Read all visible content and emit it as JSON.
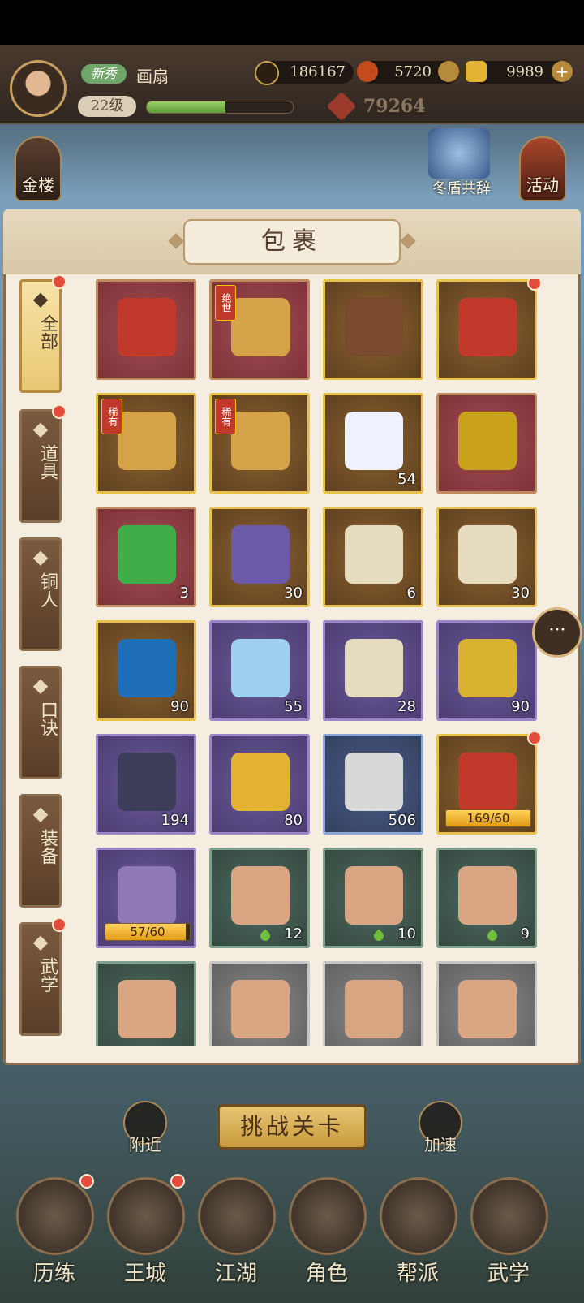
{
  "header": {
    "rank_badge": "新秀",
    "player_name": "画扇",
    "level": "22级",
    "exp_fraction": 0.54,
    "resources": [
      {
        "name": "coins",
        "icon": "coin-icon",
        "value": "186167"
      },
      {
        "name": "energy",
        "icon": "flame-icon",
        "value": "5720"
      },
      {
        "name": "gold-ingot",
        "icon": "ingot-icon",
        "value": "9989"
      }
    ],
    "power": "79264"
  },
  "side": {
    "left_label": "金楼",
    "right_label": "活动",
    "event_label": "冬盾共辞"
  },
  "panel": {
    "title": "包裹",
    "categories": [
      {
        "label": "全部",
        "icon": "fan-icon",
        "active": true,
        "dot": true
      },
      {
        "label": "道具",
        "icon": "pouch-icon",
        "active": false,
        "dot": true
      },
      {
        "label": "铜人",
        "icon": "figure-icon",
        "active": false,
        "dot": false
      },
      {
        "label": "口诀",
        "icon": "scroll-icon",
        "active": false,
        "dot": false
      },
      {
        "label": "装备",
        "icon": "armor-icon",
        "active": false,
        "dot": false
      },
      {
        "label": "武学",
        "icon": "book-icon",
        "active": false,
        "dot": true
      }
    ],
    "items": [
      {
        "name": "贺 red envelope pack",
        "rarity": "red",
        "art": "#c0392b",
        "count": "",
        "dot": false
      },
      {
        "name": "绝世 manual chest",
        "rarity": "red",
        "art": "#d4a34a",
        "count": "",
        "tag": "绝世",
        "dot": false
      },
      {
        "name": "gem treasure box",
        "rarity": "gold",
        "art": "#7a4a2e",
        "count": "",
        "dot": false
      },
      {
        "name": "武学秘籍 book",
        "rarity": "gold",
        "art": "#c0392b",
        "count": "",
        "dot": true
      },
      {
        "name": "稀有 manual chest",
        "rarity": "gold",
        "art": "#d4a34a",
        "count": "",
        "tag": "稀有",
        "dot": false
      },
      {
        "name": "稀有 manual chest",
        "rarity": "gold",
        "art": "#d4a34a",
        "count": "",
        "tag": "稀有",
        "dot": false
      },
      {
        "name": "mochi spirit",
        "rarity": "gold",
        "art": "#eef2ff",
        "count": "54",
        "dot": false
      },
      {
        "name": "特 gold shard",
        "rarity": "red",
        "art": "#c9a21a",
        "count": "",
        "dot": false
      },
      {
        "name": "武 jade",
        "rarity": "red",
        "art": "#3fae48",
        "count": "3",
        "dot": false
      },
      {
        "name": "rainbow flower",
        "rarity": "gold",
        "art": "#6a5aa8",
        "count": "30",
        "dot": false
      },
      {
        "name": "千机 scroll",
        "rarity": "gold",
        "art": "#e6dcc0",
        "count": "6",
        "dot": false
      },
      {
        "name": "千机 package",
        "rarity": "gold",
        "art": "#e6dcc0",
        "count": "30",
        "dot": false
      },
      {
        "name": "blue flame orb",
        "rarity": "gold",
        "art": "#1e6fb8",
        "count": "90",
        "dot": false
      },
      {
        "name": "crystal gem",
        "rarity": "purple",
        "art": "#9fd0ef",
        "count": "55",
        "dot": false
      },
      {
        "name": "擂台 scroll",
        "rarity": "purple",
        "art": "#e6dcc0",
        "count": "28",
        "dot": false
      },
      {
        "name": "gold star crystal",
        "rarity": "purple",
        "art": "#d9b232",
        "count": "90",
        "dot": false
      },
      {
        "name": "iron ore",
        "rarity": "purple",
        "art": "#3d3f5a",
        "count": "194",
        "dot": false
      },
      {
        "name": "gold nugget",
        "rarity": "purple",
        "art": "#e3b233",
        "count": "80",
        "dot": false
      },
      {
        "name": "scroll with tassel",
        "rarity": "blue",
        "art": "#d8d8d8",
        "count": "506",
        "dot": false
      },
      {
        "name": "武林秘籍 red",
        "rarity": "gold",
        "art": "#c0392b",
        "progress": "169/60",
        "progress_value": 1.0,
        "dot": true
      },
      {
        "name": "武林秘籍 purple",
        "rarity": "purple",
        "art": "#8e78b8",
        "progress": "57/60",
        "progress_value": 0.95,
        "dot": false
      },
      {
        "name": "kick stance page",
        "rarity": "green",
        "art": "#d9a583",
        "count": "12",
        "leaf": true,
        "dot": false
      },
      {
        "name": "lunge stance page",
        "rarity": "green",
        "art": "#d9a583",
        "count": "10",
        "leaf": true,
        "dot": false
      },
      {
        "name": "meditation page",
        "rarity": "green",
        "art": "#d9a583",
        "count": "9",
        "leaf": true,
        "dot": false
      },
      {
        "name": "martial page",
        "rarity": "green",
        "art": "#d9a583",
        "count": "",
        "dot": false
      },
      {
        "name": "martial page",
        "rarity": "gray",
        "art": "#d9a583",
        "count": "",
        "dot": false
      },
      {
        "name": "martial page",
        "rarity": "gray",
        "art": "#d9a583",
        "count": "",
        "dot": false
      },
      {
        "name": "martial page",
        "rarity": "gray",
        "art": "#d9a583",
        "count": "",
        "dot": false
      }
    ]
  },
  "bottom": {
    "challenge_label": "挑战关卡",
    "nearby_label": "附近",
    "speedup_label": "加速",
    "nav": [
      {
        "label": "历练",
        "icon": "training-icon",
        "dot": true
      },
      {
        "label": "王城",
        "icon": "castle-icon",
        "dot": true
      },
      {
        "label": "江湖",
        "icon": "sword-icon",
        "dot": false
      },
      {
        "label": "角色",
        "icon": "character-icon",
        "dot": false
      },
      {
        "label": "帮派",
        "icon": "guild-icon",
        "dot": false
      },
      {
        "label": "武学",
        "icon": "scroll-stack-icon",
        "dot": false
      }
    ]
  }
}
